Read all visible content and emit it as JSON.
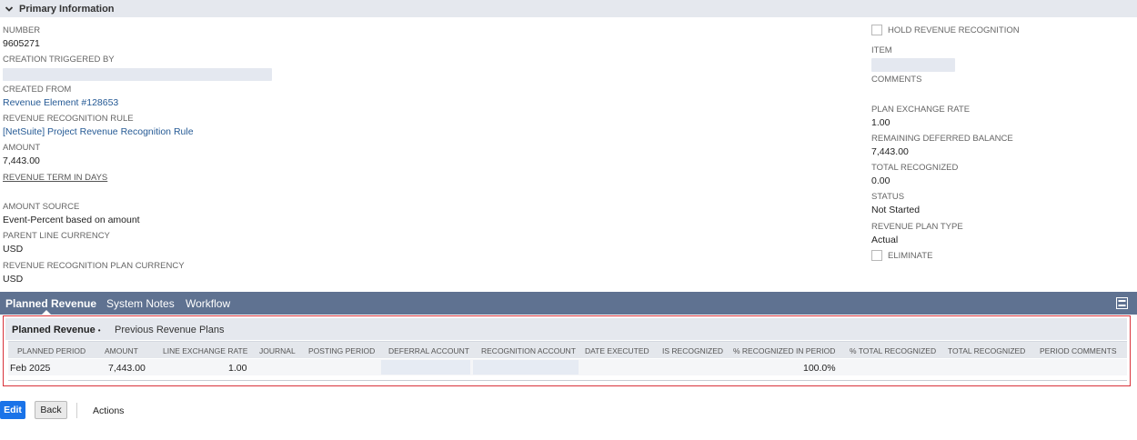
{
  "section": {
    "title": "Primary Information"
  },
  "left_fields": {
    "number": {
      "label": "NUMBER",
      "value": "9605271"
    },
    "creation_triggered_by": {
      "label": "CREATION TRIGGERED BY"
    },
    "created_from": {
      "label": "CREATED FROM",
      "value": "Revenue Element #128653"
    },
    "rev_rec_rule": {
      "label": "REVENUE RECOGNITION RULE",
      "value": "[NetSuite] Project Revenue Recognition Rule"
    },
    "amount": {
      "label": "AMOUNT",
      "value": "7,443.00"
    },
    "revenue_term": {
      "label": "REVENUE TERM IN DAYS"
    },
    "amount_source": {
      "label": "AMOUNT SOURCE",
      "value": "Event-Percent based on amount"
    },
    "parent_line_currency": {
      "label": "PARENT LINE CURRENCY",
      "value": "USD"
    },
    "plan_currency": {
      "label": "REVENUE RECOGNITION PLAN CURRENCY",
      "value": "USD"
    }
  },
  "right_fields": {
    "hold_rev_rec": {
      "label": "HOLD REVENUE RECOGNITION",
      "checked": false
    },
    "item": {
      "label": "ITEM"
    },
    "comments": {
      "label": "COMMENTS"
    },
    "plan_exchange_rate": {
      "label": "PLAN EXCHANGE RATE",
      "value": "1.00"
    },
    "remaining_deferred": {
      "label": "REMAINING DEFERRED BALANCE",
      "value": "7,443.00"
    },
    "total_recognized": {
      "label": "TOTAL RECOGNIZED",
      "value": "0.00"
    },
    "status": {
      "label": "STATUS",
      "value": "Not Started"
    },
    "plan_type": {
      "label": "REVENUE PLAN TYPE",
      "value": "Actual"
    },
    "eliminate": {
      "label": "ELIMINATE",
      "checked": false
    }
  },
  "tabs": [
    {
      "label": "Planned Revenue"
    },
    {
      "label": "System Notes"
    },
    {
      "label": "Workflow"
    }
  ],
  "subtabs": [
    {
      "label": "Planned Revenue",
      "marker": "•"
    },
    {
      "label": "Previous Revenue Plans"
    }
  ],
  "grid": {
    "columns": [
      "PLANNED PERIOD",
      "AMOUNT",
      "LINE EXCHANGE RATE",
      "JOURNAL",
      "POSTING PERIOD",
      "DEFERRAL ACCOUNT",
      "RECOGNITION ACCOUNT",
      "DATE EXECUTED",
      "IS RECOGNIZED",
      "% RECOGNIZED IN PERIOD",
      "% TOTAL RECOGNIZED",
      "TOTAL RECOGNIZED",
      "PERIOD COMMENTS"
    ],
    "rows": [
      {
        "planned_period": "Feb 2025",
        "amount": "7,443.00",
        "line_exchange_rate": "1.00",
        "pct_recognized_in_period": "100.0%"
      }
    ]
  },
  "buttons": {
    "edit": "Edit",
    "back": "Back",
    "actions": "Actions"
  },
  "colors": {
    "tabbar": "#5f7291",
    "highlight_border": "#d9333b",
    "link": "#255a95",
    "primary_button": "#1a73e8"
  }
}
